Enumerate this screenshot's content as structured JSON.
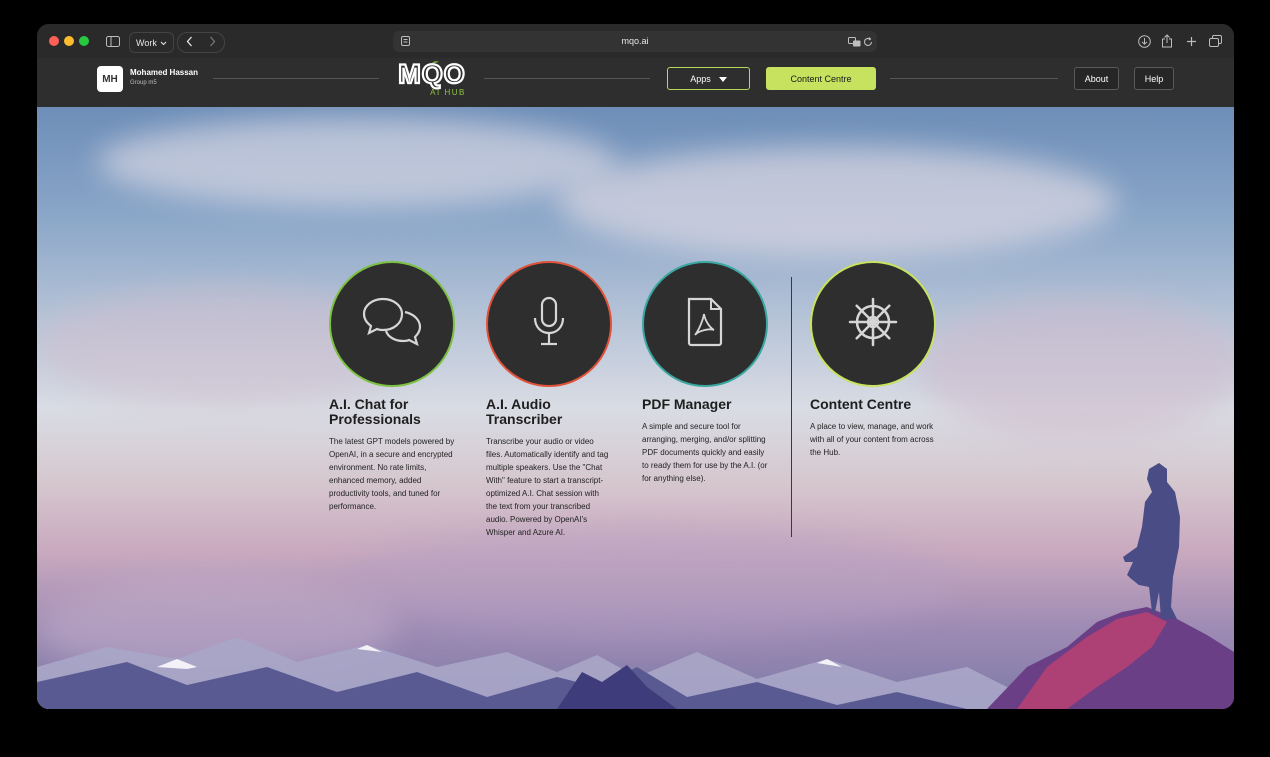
{
  "browser": {
    "tab_group": "Work",
    "url": "mqo.ai"
  },
  "header": {
    "avatar_initials": "MH",
    "user_name": "Mohamed Hassan",
    "user_group": "Group m5",
    "logo_text": "MQO",
    "logo_sub": "AI HUB",
    "apps_label": "Apps",
    "content_centre_label": "Content Centre",
    "about_label": "About",
    "help_label": "Help"
  },
  "cards": [
    {
      "title": "A.I. Chat for Professionals",
      "icon": "chat-bubbles-icon",
      "ring": "#7cc142",
      "description": "The latest GPT models powered by OpenAI, in a secure and encrypted environment. No rate limits, enhanced memory, added productivity tools, and tuned for performance."
    },
    {
      "title": "A.I. Audio Transcriber",
      "icon": "microphone-icon",
      "ring": "#e0523a",
      "description": "Transcribe your audio or video files. Automatically identify and tag multiple speakers. Use the \"Chat With\" feature to start a transcript-optimized A.I. Chat session with the text from your transcribed audio. Powered by OpenAI's Whisper and Azure AI."
    },
    {
      "title": "PDF Manager",
      "icon": "pdf-file-icon",
      "ring": "#3aa7a0",
      "description": "A simple and secure tool for arranging, merging, and/or splitting PDF documents quickly and easily to ready them for use by the A.I. (or for anything else)."
    },
    {
      "title": "Content Centre",
      "icon": "ship-wheel-icon",
      "ring": "#c6e25e",
      "description": "A place to view, manage, and work with all of your content from across the Hub."
    }
  ]
}
